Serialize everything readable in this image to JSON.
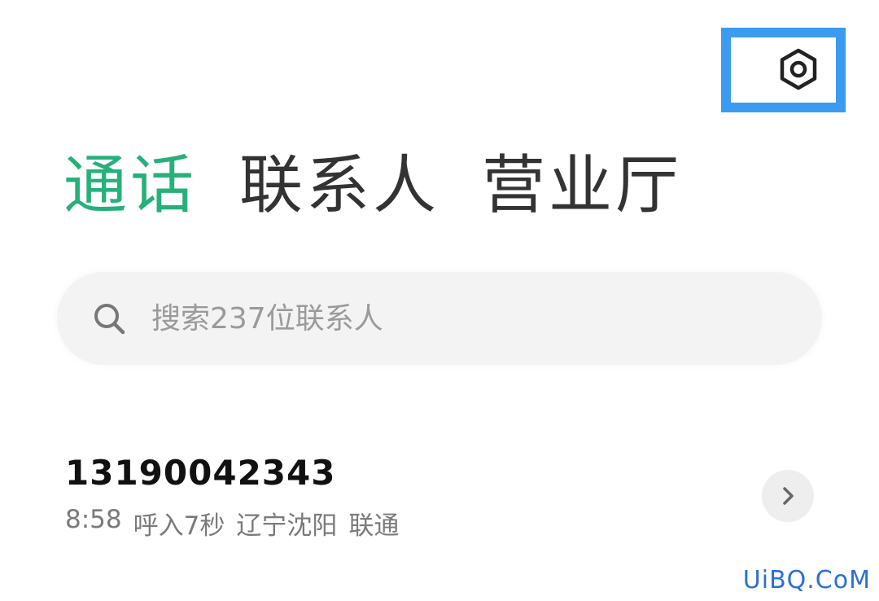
{
  "colors": {
    "accent": "#27b07a",
    "highlight_border": "#3b9bf0",
    "tab_text": "#333333",
    "muted_text": "#7a7a7a",
    "watermark": "#2a6fd8"
  },
  "header": {
    "settings_icon": "settings-hexagon-icon"
  },
  "tabs": [
    {
      "label": "通话",
      "active": true
    },
    {
      "label": "联系人",
      "active": false
    },
    {
      "label": "营业厅",
      "active": false
    }
  ],
  "search": {
    "icon": "search-icon",
    "placeholder": "搜索237位联系人"
  },
  "call_log": [
    {
      "number": "13190042343",
      "time": "8:58",
      "type_duration": "呼入7秒",
      "location": "辽宁沈阳",
      "carrier": "联通",
      "detail_icon": "chevron-right-icon"
    }
  ],
  "watermark": "UiBQ.CoM"
}
